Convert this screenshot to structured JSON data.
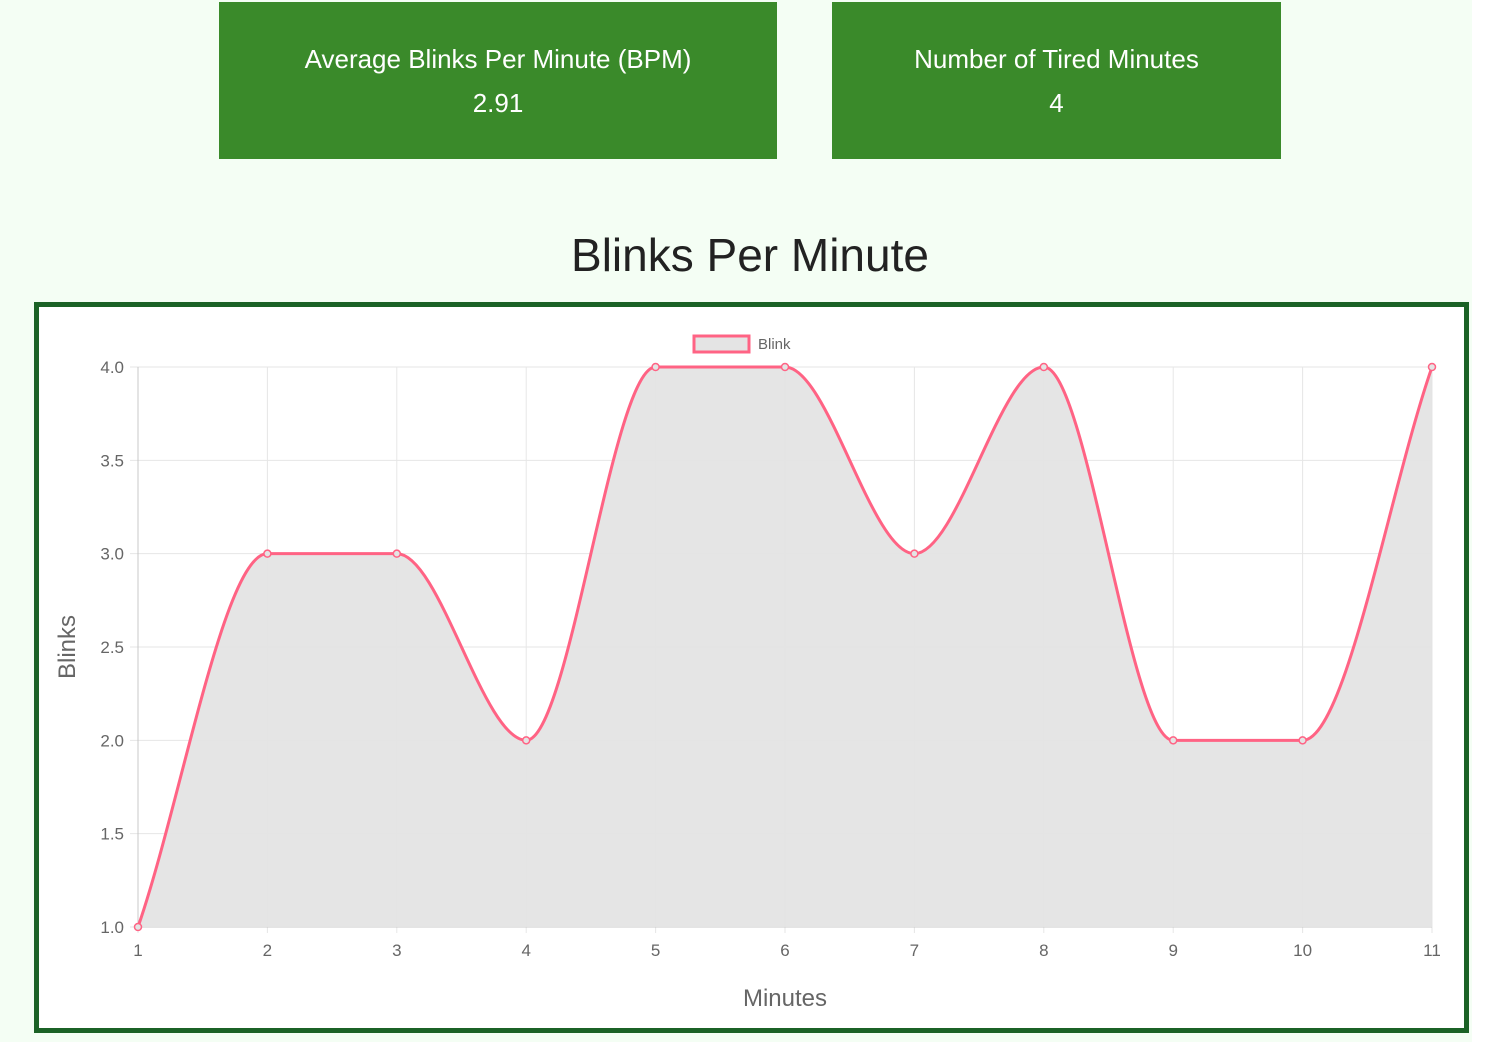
{
  "stats": {
    "average_bpm": {
      "label": "Average Blinks Per Minute (BPM)",
      "value": "2.91"
    },
    "tired_minutes": {
      "label": "Number of Tired Minutes",
      "value": "4"
    }
  },
  "heading": "Blinks Per Minute",
  "colors": {
    "card_bg": "#3a8a2a",
    "frame_border": "#1b6226",
    "page_bg": "#f4fef4",
    "line": "#ff6384",
    "fill": "#e4e4e4"
  },
  "chart_data": {
    "type": "line",
    "title": "",
    "xlabel": "Minutes",
    "ylabel": "Blinks",
    "x": [
      1,
      2,
      3,
      4,
      5,
      6,
      7,
      8,
      9,
      10,
      11
    ],
    "series": [
      {
        "name": "Blink",
        "values": [
          1,
          3,
          3,
          2,
          4,
          4,
          3,
          4,
          2,
          2,
          4
        ]
      }
    ],
    "ylim": [
      1.0,
      4.0
    ],
    "yticks": [
      "1.0",
      "1.5",
      "2.0",
      "2.5",
      "3.0",
      "3.5",
      "4.0"
    ],
    "xticks": [
      "1",
      "2",
      "3",
      "4",
      "5",
      "6",
      "7",
      "8",
      "9",
      "10",
      "11"
    ],
    "grid": true,
    "legend": "top-center",
    "fill": true
  }
}
